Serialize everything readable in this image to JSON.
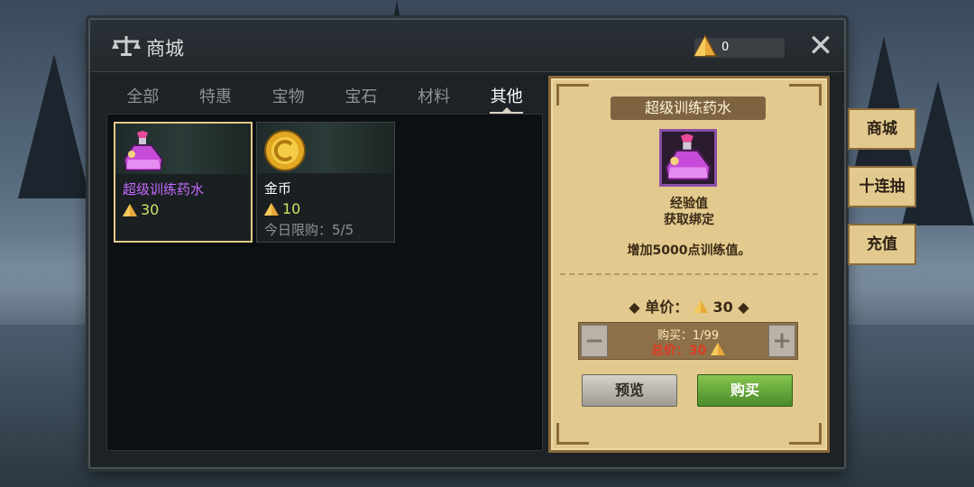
{
  "window": {
    "title": "商城"
  },
  "currency": {
    "value": "0",
    "icon": "triangle-gem-icon",
    "color": "#e8a93a"
  },
  "tabs": [
    {
      "label": "全部",
      "active": false
    },
    {
      "label": "特惠",
      "active": false
    },
    {
      "label": "宝物",
      "active": false
    },
    {
      "label": "宝石",
      "active": false
    },
    {
      "label": "材料",
      "active": false
    },
    {
      "label": "其他",
      "active": true
    }
  ],
  "items": [
    {
      "name": "超级训练药水",
      "name_color": "#c66bff",
      "price": "30",
      "icon": "potion-icon",
      "limit": "",
      "selected": true
    },
    {
      "name": "金币",
      "name_color": "#ffffff",
      "price": "10",
      "icon": "gold-coin-icon",
      "limit": "今日限购：5/5",
      "selected": false
    }
  ],
  "detail": {
    "title": "超级训练药水",
    "type": "经验值",
    "bind": "获取绑定",
    "description": "增加5000点训练值。",
    "unit_price_label": "◆ 单价：",
    "unit_price": "30",
    "unit_price_suffix": " ◆",
    "quantity": "购买：1/99",
    "total": "总价：30",
    "preview_label": "预览",
    "buy_label": "购买"
  },
  "side_buttons": [
    {
      "label": "商城"
    },
    {
      "label": "十连抽"
    },
    {
      "label": "充值"
    }
  ]
}
